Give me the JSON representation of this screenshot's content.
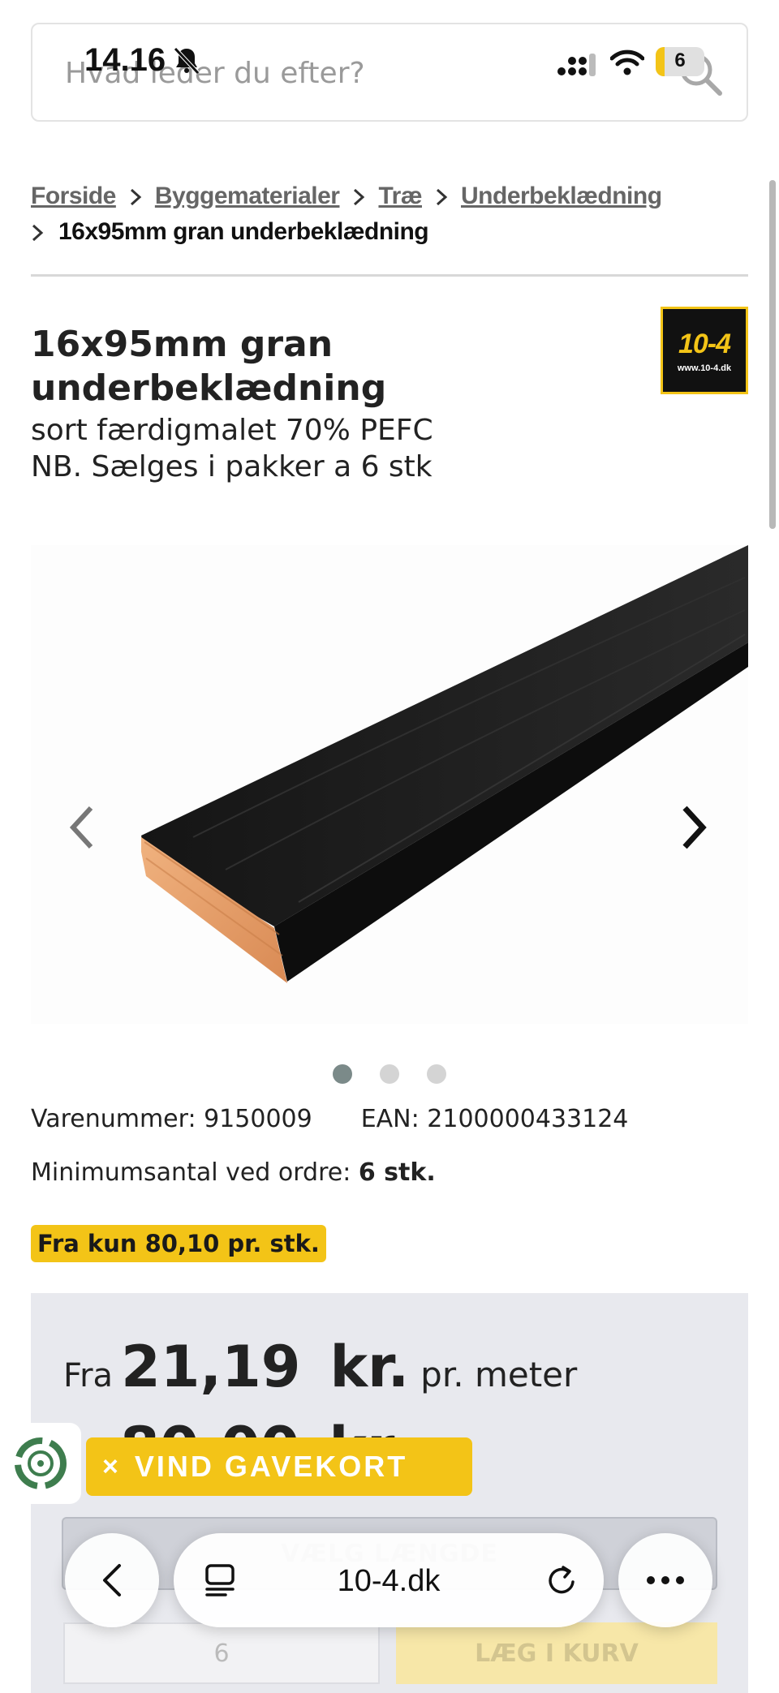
{
  "status_bar": {
    "time": "14.16",
    "battery": "6",
    "battery_level_percent": 6,
    "icons": [
      "bell-slash-icon",
      "cellular-signal-icon",
      "wifi-icon",
      "battery-icon"
    ]
  },
  "search": {
    "placeholder": "Hvad leder du efter?",
    "icon": "search-icon"
  },
  "breadcrumb": {
    "items": [
      "Forside",
      "Byggematerialer",
      "Træ",
      "Underbeklædning"
    ],
    "current": "16x95mm gran underbeklædning"
  },
  "product": {
    "title": "16x95mm gran underbeklædning",
    "subtitle_line1": "sort færdigmalet 70% PEFC",
    "subtitle_line2": "NB. Sælges i pakker a 6 stk",
    "brand_logo_text": "10-4",
    "brand_logo_url": "www.10-4.dk",
    "varenummer": "Varenummer: 9150009",
    "ean": "EAN: 2100000433124",
    "min_label": "Minimumsantal ved ordre:",
    "min_value": "6 stk.",
    "promo": "Fra kun 80,10 pr. stk."
  },
  "gallery": {
    "total_images": 3,
    "active_index": 0,
    "prev_icon": "chevron-left-icon",
    "next_icon": "chevron-right-icon"
  },
  "price": {
    "from_label": "Fra",
    "value": "21,19",
    "currency": "kr.",
    "unit": "pr. meter",
    "second_value": "80,00",
    "second_currency": "kr.",
    "select_button": "VÆLG LÆNGDE",
    "quantity": "6",
    "cart_button": "LÆG I KURV"
  },
  "gift_banner": {
    "close": "×",
    "label": "VIND GAVEKORT"
  },
  "safari": {
    "url": "10-4.dk"
  },
  "colors": {
    "accent_yellow": "#f3c417",
    "price_box_bg": "#e8e9ee",
    "active_dot": "#7b8a89"
  }
}
